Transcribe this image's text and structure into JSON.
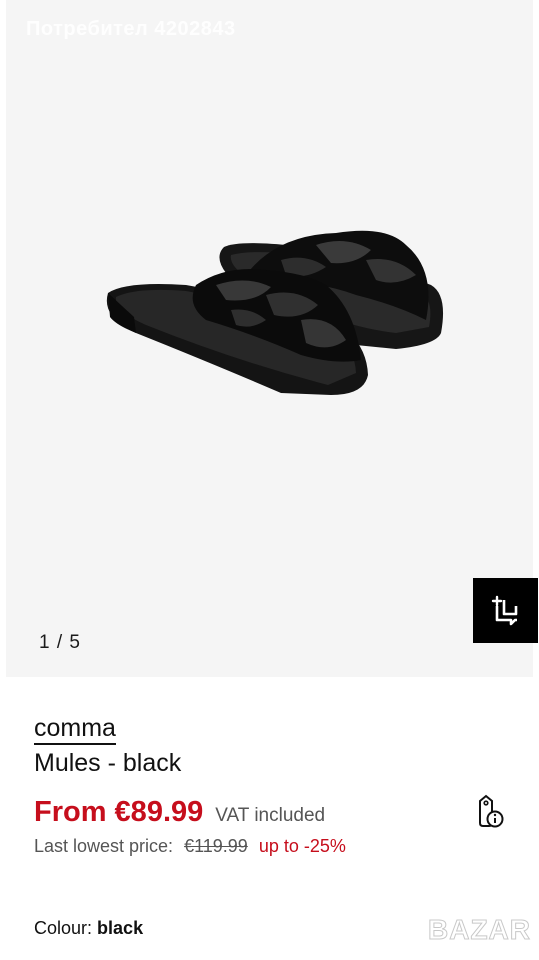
{
  "watermark_top": "Потребител 4202843",
  "gallery": {
    "counter": "1 / 5",
    "product_image_alt": "black braided mules",
    "ar_icon": "view-in-room-icon"
  },
  "product": {
    "brand": "comma",
    "name": "Mules - black",
    "price_from": "From €89.99",
    "vat": "VAT included",
    "lowest_label": "Last lowest price:",
    "lowest_old": "€119.99",
    "lowest_discount": "up to -25%",
    "price_info_icon": "price-tag-info-icon"
  },
  "colour": {
    "label": "Colour:",
    "value": "black"
  },
  "watermark_bottom": "BAZAR",
  "colors": {
    "price_red": "#c60e1c",
    "gallery_bg": "#f5f5f5",
    "ar_button_bg": "#000000"
  }
}
